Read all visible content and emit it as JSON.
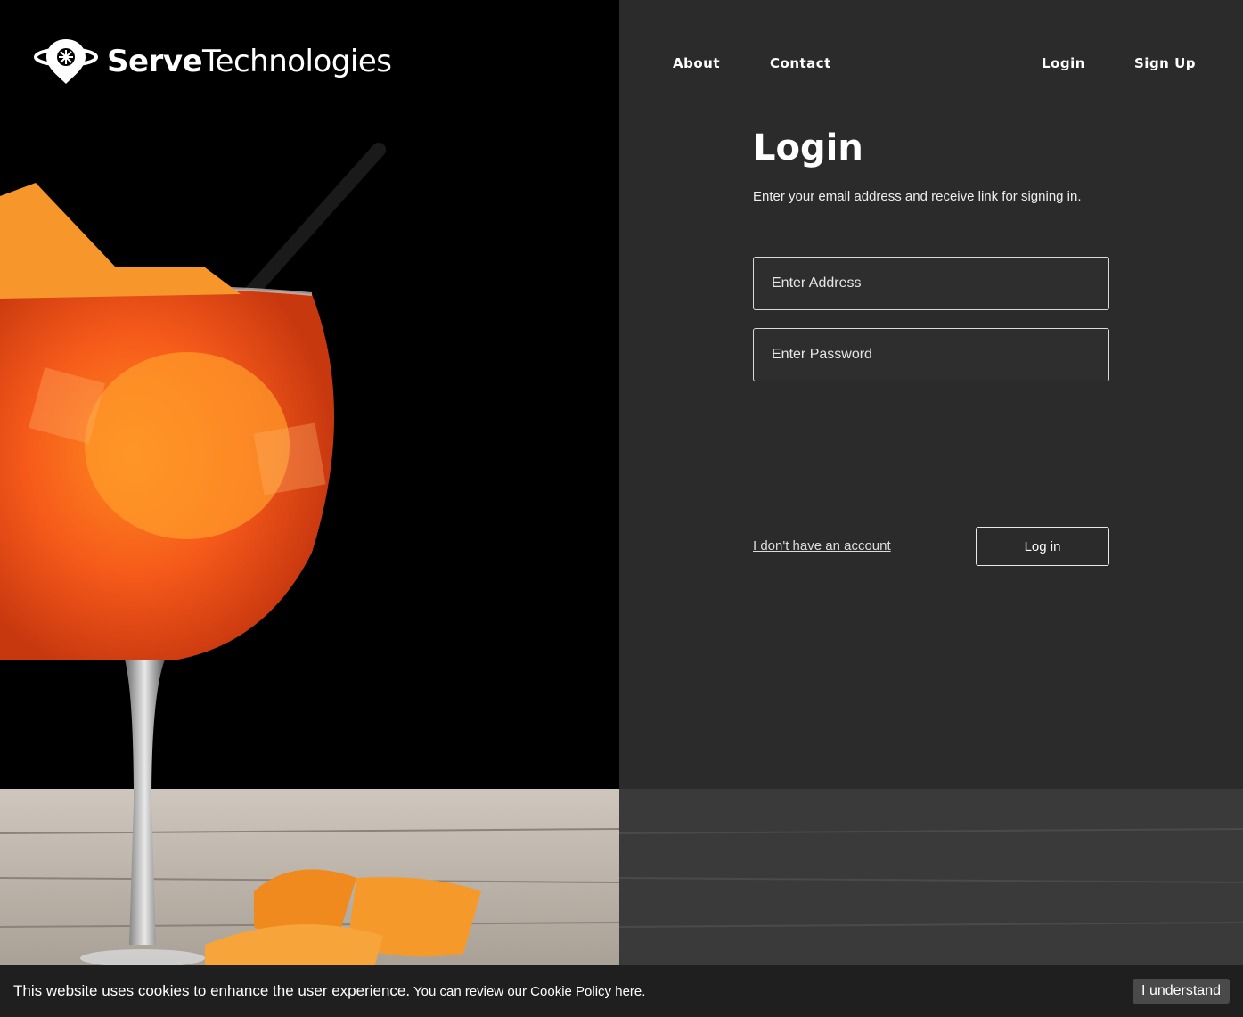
{
  "brand": {
    "name_bold": "Serve",
    "name_light": "Technologies"
  },
  "nav": {
    "about": "About",
    "contact": "Contact",
    "login": "Login",
    "signup": "Sign Up"
  },
  "login_form": {
    "title": "Login",
    "subtitle": "Enter your email address and receive link for signing in.",
    "email_placeholder": "Enter Address",
    "password_placeholder": "Enter Password",
    "no_account_link": "I don't have an account",
    "submit_label": "Log in"
  },
  "cookie_banner": {
    "message": "This website uses cookies to enhance the user experience.",
    "policy_text": " You can review our Cookie Policy here.",
    "accept_label": "I understand"
  },
  "colors": {
    "right_panel_bg": "#2b2b2b",
    "left_panel_bg": "#000000",
    "cookie_bar_bg": "#1f1f1f",
    "accent_orange": "#f26a1b"
  },
  "icons": {
    "logo": "planet-ring-pin-icon",
    "hero": "orange-spritz-cocktail-photo"
  }
}
